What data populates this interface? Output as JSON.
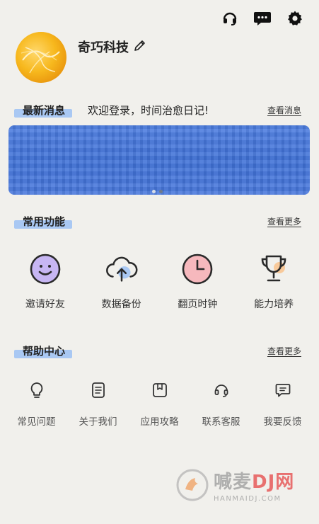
{
  "header": {
    "icons": [
      "headset-icon",
      "chat-icon",
      "gear-icon"
    ]
  },
  "profile": {
    "name": "奇巧科技",
    "edit_icon": "pencil-icon"
  },
  "news": {
    "title": "最新消息",
    "message": "欢迎登录，时间治愈日记!",
    "more": "查看消息"
  },
  "banner": {
    "pages": 2,
    "active_page": 1
  },
  "functions": {
    "title": "常用功能",
    "more": "查看更多",
    "items": [
      {
        "label": "邀请好友",
        "icon": "smiley-icon"
      },
      {
        "label": "数据备份",
        "icon": "cloud-upload-icon"
      },
      {
        "label": "翻页时钟",
        "icon": "clock-icon"
      },
      {
        "label": "能力培养",
        "icon": "trophy-icon"
      }
    ]
  },
  "help": {
    "title": "帮助中心",
    "more": "查看更多",
    "items": [
      {
        "label": "常见问题",
        "icon": "lightbulb-icon"
      },
      {
        "label": "关于我们",
        "icon": "document-icon"
      },
      {
        "label": "应用攻略",
        "icon": "bookmark-icon"
      },
      {
        "label": "联系客服",
        "icon": "headset-icon"
      },
      {
        "label": "我要反馈",
        "icon": "message-icon"
      }
    ]
  },
  "watermark": {
    "main": "喊麦",
    "brand": "DJ网",
    "sub": "HANMAIDJ.COM"
  },
  "colors": {
    "background": "#f1f0ec",
    "highlight": "#a9c8f3",
    "banner": "#4576dc",
    "accent_purple": "#c7b6f3",
    "accent_pink": "#f6b8bd",
    "accent_orange": "#f8c99a"
  }
}
